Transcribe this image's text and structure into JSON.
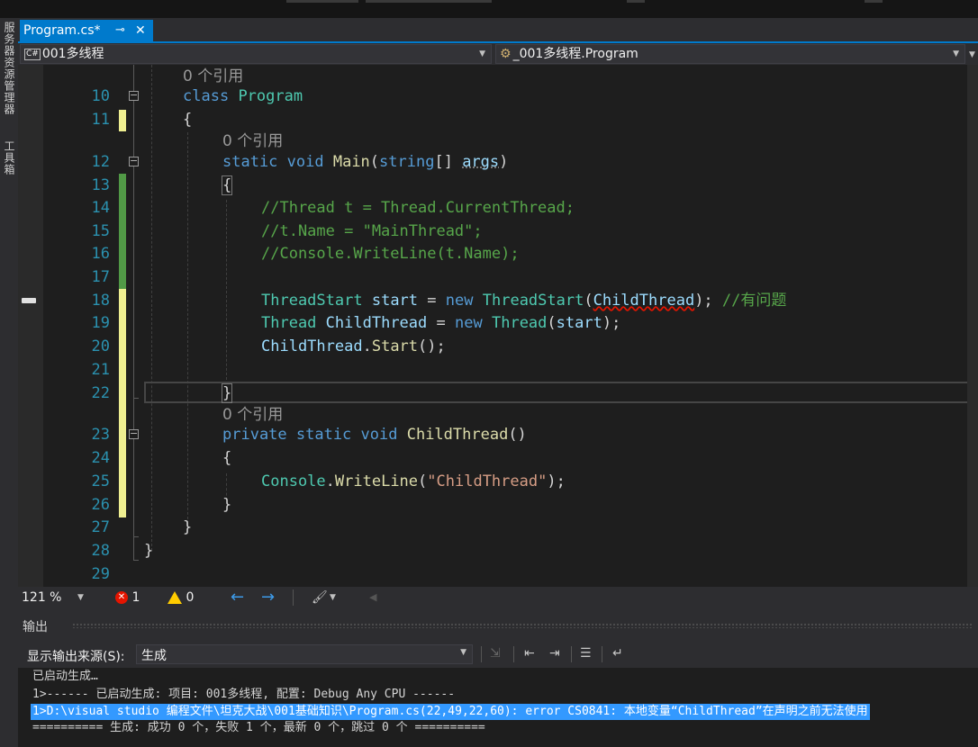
{
  "tab": {
    "title": "Program.cs*",
    "pin": "⊸",
    "close": "✕"
  },
  "left_rail": {
    "item1": "服务器资源管理器",
    "item2": "工具箱"
  },
  "navbar": {
    "project": "001多线程",
    "project_badge": "C#",
    "type": "_001多线程.Program"
  },
  "code_lens": {
    "refs": "0 个引用"
  },
  "editor": {
    "lines": [
      {
        "n": "10",
        "text": "class Program"
      },
      {
        "n": "11",
        "text": "{"
      },
      {
        "n": "12",
        "text": "static void Main(string[] args)"
      },
      {
        "n": "13",
        "text": "{"
      },
      {
        "n": "14",
        "text": "//Thread t = Thread.CurrentThread;"
      },
      {
        "n": "15",
        "text": "//t.Name = \"MainThread\";"
      },
      {
        "n": "16",
        "text": "//Console.WriteLine(t.Name);"
      },
      {
        "n": "17",
        "text": ""
      },
      {
        "n": "18",
        "text": "ThreadStart start = new ThreadStart(ChildThread); //有问题"
      },
      {
        "n": "19",
        "text": "Thread ChildThread = new Thread(start);"
      },
      {
        "n": "20",
        "text": "ChildThread.Start();"
      },
      {
        "n": "21",
        "text": ""
      },
      {
        "n": "22",
        "text": "}"
      },
      {
        "n": "23",
        "text": "private static void ChildThread()"
      },
      {
        "n": "24",
        "text": "{"
      },
      {
        "n": "25",
        "text": "Console.WriteLine(\"ChildThread\");"
      },
      {
        "n": "26",
        "text": "}"
      },
      {
        "n": "27",
        "text": "}"
      },
      {
        "n": "28",
        "text": "}"
      },
      {
        "n": "29",
        "text": ""
      }
    ],
    "comment_18": "//有问题"
  },
  "status": {
    "zoom": "121 %",
    "errors": "1",
    "warnings": "0"
  },
  "output": {
    "title": "输出",
    "source_label": "显示输出来源(S):",
    "source_value": "生成",
    "lines": [
      "已启动生成…",
      "1>------ 已启动生成: 项目: 001多线程, 配置: Debug Any CPU ------",
      "1>D:\\visual studio 编程文件\\坦克大战\\001基础知识\\Program.cs(22,49,22,60): error CS0841: 本地变量“ChildThread”在声明之前无法使用",
      "========== 生成: 成功 0 个，失败 1 个，最新 0 个，跳过 0 个 =========="
    ]
  },
  "colors": {
    "accent": "#007acc",
    "keyword": "#569cd6",
    "type": "#4ec9b0",
    "comment": "#57a64a",
    "string": "#d69d85",
    "error": "#e51400"
  }
}
